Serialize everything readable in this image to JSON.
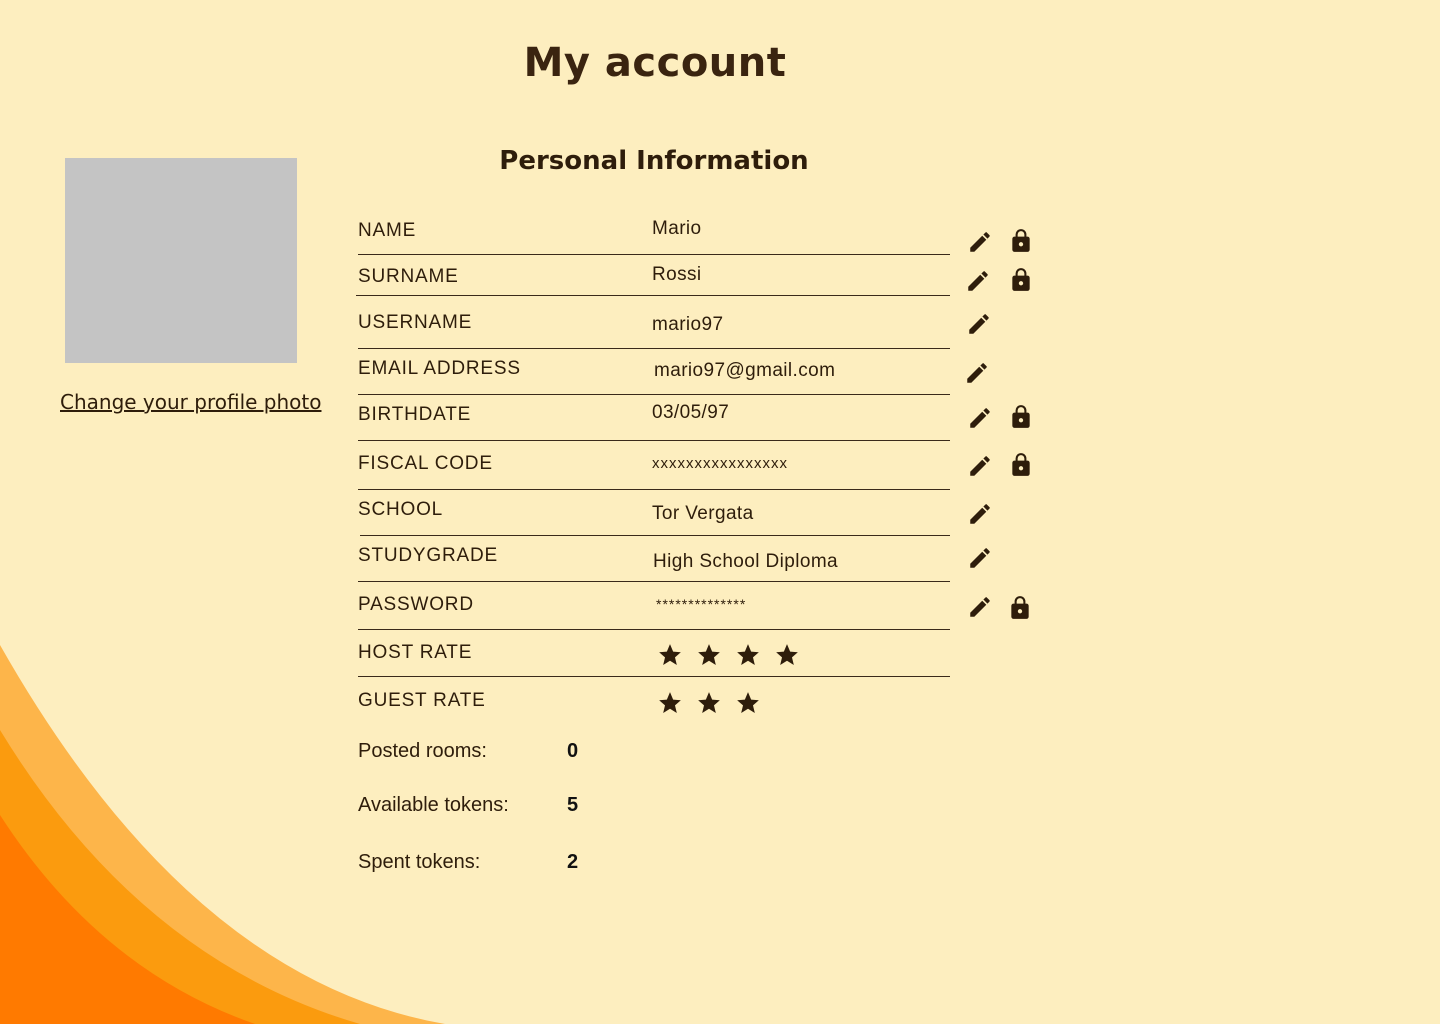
{
  "page": {
    "title": "My account",
    "section_title": "Personal Information"
  },
  "profile": {
    "change_photo_label": "Change your profile photo"
  },
  "fields": [
    {
      "label": "NAME",
      "value": "Mario",
      "editable": true,
      "locked": true
    },
    {
      "label": "SURNAME",
      "value": "Rossi",
      "editable": true,
      "locked": true
    },
    {
      "label": "USERNAME",
      "value": "mario97",
      "editable": true,
      "locked": false
    },
    {
      "label": "EMAIL ADDRESS",
      "value": "mario97@gmail.com",
      "editable": true,
      "locked": false
    },
    {
      "label": "BIRTHDATE",
      "value": "03/05/97",
      "editable": true,
      "locked": true
    },
    {
      "label": "FISCAL CODE",
      "value": "xxxxxxxxxxxxxxxx",
      "editable": true,
      "locked": true
    },
    {
      "label": "SCHOOL",
      "value": "Tor Vergata",
      "editable": true,
      "locked": false
    },
    {
      "label": "STUDYGRADE",
      "value": "High School Diploma",
      "editable": true,
      "locked": false
    },
    {
      "label": "PASSWORD",
      "value": "**************",
      "editable": true,
      "locked": true
    }
  ],
  "ratings": [
    {
      "label": "HOST RATE",
      "stars": 4
    },
    {
      "label": "GUEST RATE",
      "stars": 3
    }
  ],
  "stats": [
    {
      "label": "Posted rooms:",
      "value": "0"
    },
    {
      "label": "Available tokens:",
      "value": "5"
    },
    {
      "label": "Spent tokens:",
      "value": "2"
    }
  ],
  "icons": {
    "edit": "pencil-icon",
    "lock": "lock-icon",
    "rating": "star-icon"
  },
  "colors": {
    "background": "#fdeebf",
    "text": "#2e1d0b",
    "photo_placeholder": "#c4c4c4",
    "wave_light": "#fdb54a",
    "wave_mid": "#fb9b0e",
    "wave_dark": "#ff7a00"
  }
}
